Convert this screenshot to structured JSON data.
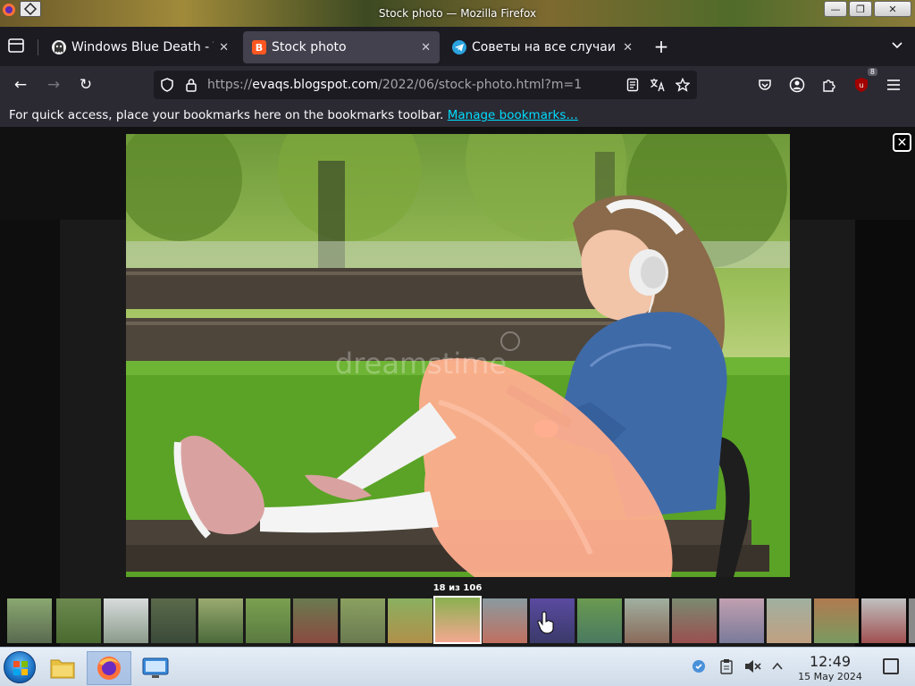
{
  "window": {
    "title": "Stock photo — Mozilla Firefox",
    "minimize_glyph": "—",
    "maximize_glyph": "❐",
    "close_glyph": "✕"
  },
  "tabs": [
    {
      "label": "Windows Blue Death - Te",
      "favicon": "ghost-icon",
      "active": false
    },
    {
      "label": "Stock photo",
      "favicon": "blogger-icon",
      "active": true
    },
    {
      "label": "Советы на все случаи ж",
      "favicon": "telegram-icon",
      "active": false
    }
  ],
  "tab_close_glyph": "✕",
  "new_tab_glyph": "+",
  "nav": {
    "back_glyph": "←",
    "forward_glyph": "→",
    "reload_glyph": "↻",
    "url_scheme": "https://",
    "url_host": "evaqs.blogspot.com",
    "url_path": "/2022/06/stock-photo.html?m=1",
    "extension_badge": "8"
  },
  "bookmarks_bar": {
    "message": "For quick access, place your bookmarks here on the bookmarks toolbar. ",
    "link": "Manage bookmarks…"
  },
  "lightbox": {
    "close_glyph": "✕",
    "counter": "18 из 106",
    "current_index": 18,
    "total": 106,
    "watermark": "dreamstime"
  },
  "taskbar": {
    "time": "12:49",
    "date": "15 May 2024"
  }
}
